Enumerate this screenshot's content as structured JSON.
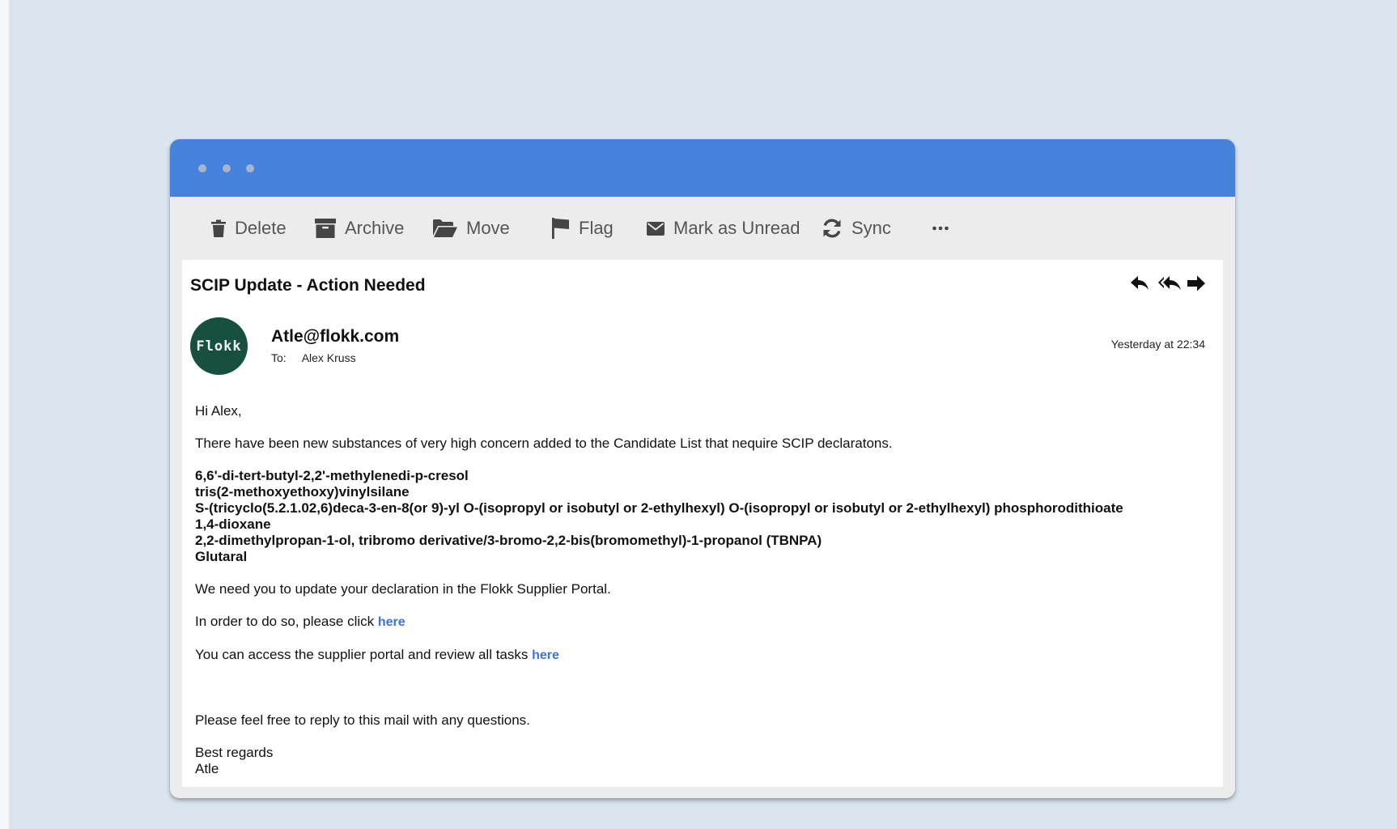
{
  "toolbar": {
    "delete": "Delete",
    "archive": "Archive",
    "move": "Move",
    "flag": "Flag",
    "mark_unread": "Mark as Unread",
    "sync": "Sync",
    "more": "more-icon"
  },
  "email": {
    "subject": "SCIP Update - Action Needed",
    "avatar_text": "Flokk",
    "sender": "Atle@flokk.com",
    "to_label": "To:",
    "to_name": "Alex Kruss",
    "date": "Yesterday at 22:34",
    "greeting": "Hi Alex,",
    "intro": "There have been new substances of very high concern added to the Candidate List that nequire SCIP declaratons.",
    "substances": [
      "6,6'-di-tert-butyl-2,2'-methylenedi-p-cresol",
      "tris(2-methoxyethoxy)vinylsilane",
      "S-(tricyclo(5.2.1.02,6)deca-3-en-8(or 9)-yl O-(isopropyl or isobutyl or 2-ethylhexyl) O-(isopropyl or isobutyl or 2-ethylhexyl) phosphorodithioate",
      "1,4-dioxane",
      "2,2-dimethylpropan-1-ol, tribromo derivative/3-bromo-2,2-bis(bromomethyl)-1-propanol (TBNPA)",
      "Glutaral"
    ],
    "update_line": "We need you to update your declaration in the Flokk Supplier Portal.",
    "click_prefix": "In order to do so, please click ",
    "click_link": "here",
    "portal_prefix": "You can access the supplier portal and review all tasks ",
    "portal_link": "here",
    "questions": "Please feel free to reply to this mail with any questions.",
    "regards": "Best regards",
    "signature": "Atle"
  },
  "colors": {
    "background": "#dae5f0",
    "titlebar": "#4681db",
    "toolbar": "#ececec",
    "avatar": "#18503f",
    "link": "#3d72d9"
  }
}
